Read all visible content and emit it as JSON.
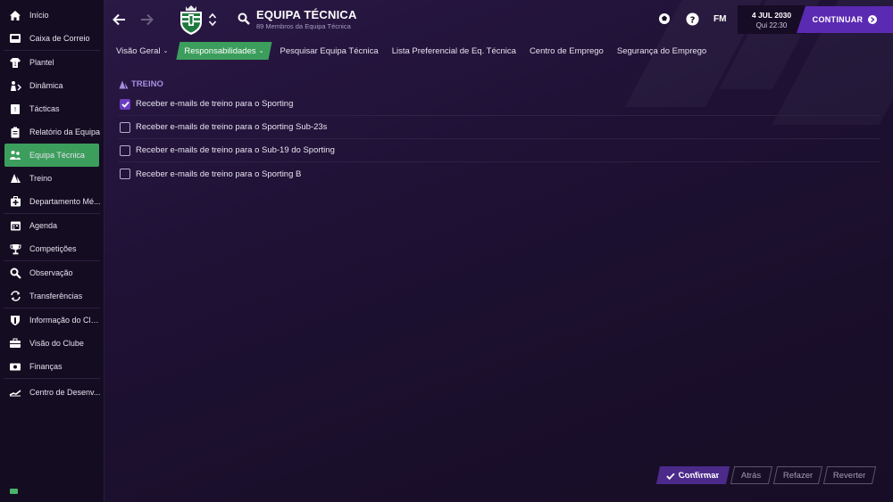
{
  "sidebar": {
    "items": [
      {
        "label": "Início",
        "icon": "home-icon"
      },
      {
        "label": "Caixa de Correio",
        "icon": "inbox-icon"
      },
      {
        "label": "Plantel",
        "icon": "shirt-icon"
      },
      {
        "label": "Dinâmica",
        "icon": "dynamics-icon"
      },
      {
        "label": "Tácticas",
        "icon": "tactics-board-icon"
      },
      {
        "label": "Relatório da Equipa",
        "icon": "clipboard-icon"
      },
      {
        "label": "Equipa Técnica",
        "icon": "staff-people-icon"
      },
      {
        "label": "Treino",
        "icon": "training-cone-icon"
      },
      {
        "label": "Departamento Mé...",
        "icon": "medical-kit-icon"
      },
      {
        "label": "Agenda",
        "icon": "calendar-icon"
      },
      {
        "label": "Competições",
        "icon": "trophy-icon"
      },
      {
        "label": "Observação",
        "icon": "magnifier-icon"
      },
      {
        "label": "Transferências",
        "icon": "transfer-arrows-icon"
      },
      {
        "label": "Informação do Clu...",
        "icon": "shield-icon"
      },
      {
        "label": "Visão do Clube",
        "icon": "briefcase-icon"
      },
      {
        "label": "Finanças",
        "icon": "money-icon"
      },
      {
        "label": "Centro de Desenv...",
        "icon": "development-chart-icon"
      }
    ],
    "active_index": 6
  },
  "header": {
    "title": "EQUIPA TÉCNICA",
    "subtitle": "89 Membros da Equipa Técnica",
    "fm_label": "FM",
    "date": "4 JUL 2030",
    "day_time": "Qui 22:30",
    "continue_label": "CONTINUAR"
  },
  "tabs": [
    {
      "label": "Visão Geral",
      "chevron": "⌄"
    },
    {
      "label": "Responsabilidades",
      "chevron": "⌄"
    },
    {
      "label": "Pesquisar Equipa Técnica",
      "chevron": ""
    },
    {
      "label": "Lista Preferencial de Eq. Técnica",
      "chevron": ""
    },
    {
      "label": "Centro de Emprego",
      "chevron": ""
    },
    {
      "label": "Segurança do Emprego",
      "chevron": ""
    }
  ],
  "section": {
    "title": "TREINO",
    "rows": [
      {
        "label": "Receber e-mails de treino para o Sporting",
        "checked": true
      },
      {
        "label": "Receber e-mails de treino para o Sporting Sub-23s",
        "checked": false
      },
      {
        "label": "Receber e-mails de treino para o Sub-19 do Sporting",
        "checked": false
      },
      {
        "label": "Receber e-mails de treino para o Sporting B",
        "checked": false
      }
    ]
  },
  "footer": {
    "confirm_label": "Confirmar",
    "back_label": "Atrás",
    "redo_label": "Refazer",
    "revert_label": "Reverter"
  },
  "colors": {
    "accent_green": "#3c9e5c",
    "accent_purple": "#5b2ab3",
    "section_purple": "#a98de0"
  }
}
